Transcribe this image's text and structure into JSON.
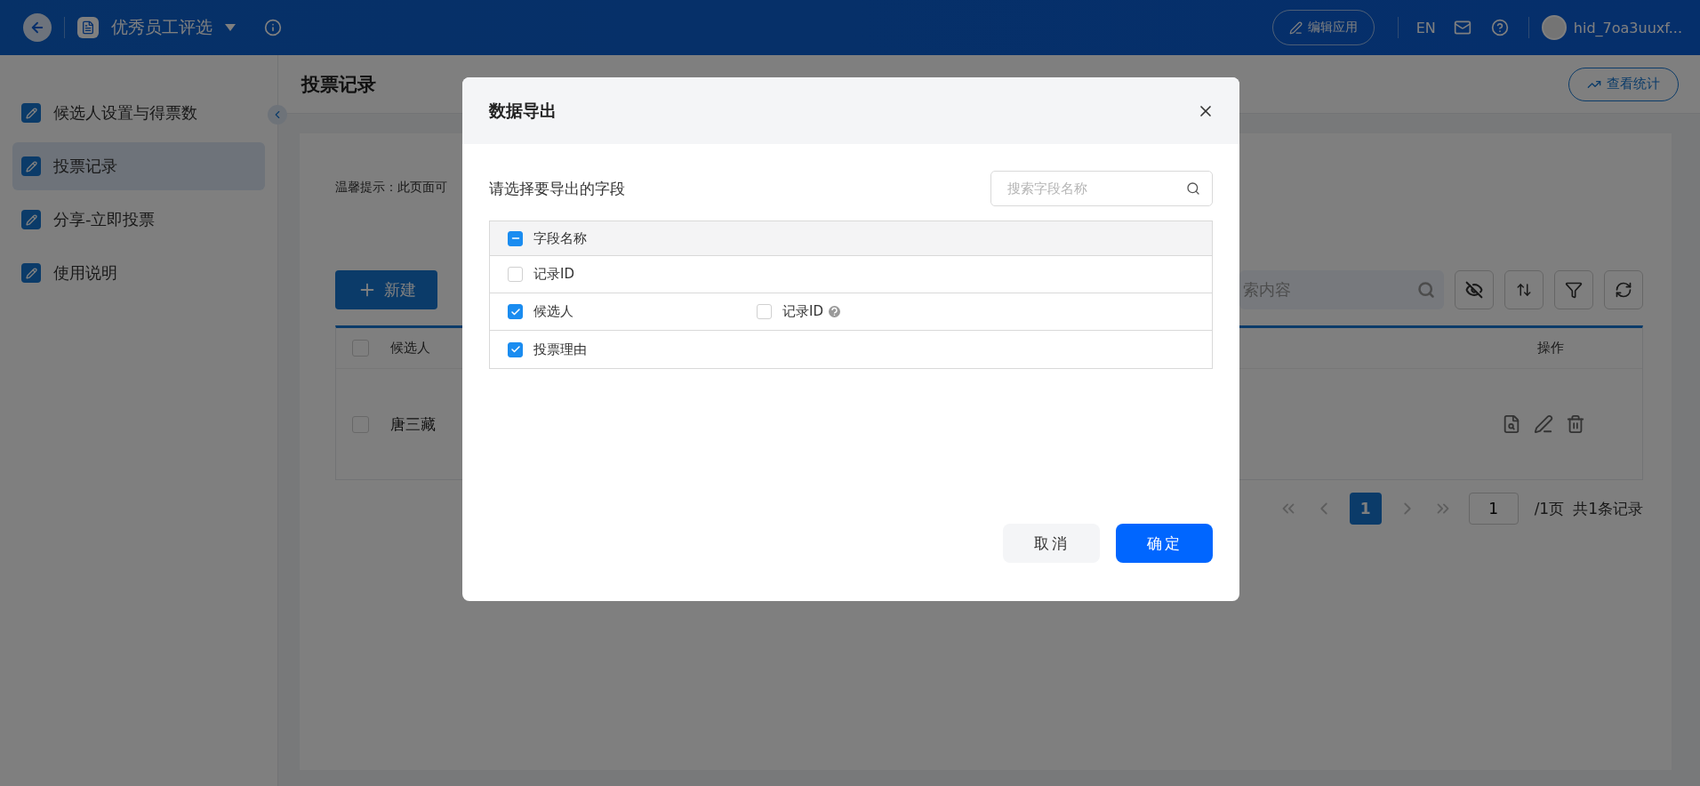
{
  "topbar": {
    "app_title": "优秀员工评选",
    "edit_button": "编辑应用",
    "language": "EN",
    "username": "hid_7oa3uuxf..."
  },
  "sidebar": {
    "items": [
      {
        "label": "候选人设置与得票数",
        "selected": false
      },
      {
        "label": "投票记录",
        "selected": true
      },
      {
        "label": "分享-立即投票",
        "selected": false
      },
      {
        "label": "使用说明",
        "selected": false
      }
    ]
  },
  "page": {
    "title": "投票记录",
    "stats_button": "查看统计",
    "tip": "温馨提示：此页面可",
    "new_button": "新建",
    "search": {
      "placeholder": "索内容"
    },
    "table": {
      "select_all": {
        "checked": false
      },
      "columns": [
        "候选人",
        "操作"
      ],
      "rows": [
        {
          "checked": false,
          "cells": [
            "唐三藏"
          ]
        }
      ]
    },
    "pagination": {
      "pages": [
        {
          "label": "1",
          "selected": true
        }
      ],
      "page_input": "1",
      "page_total": "/1页",
      "record_total": "共1条记录"
    }
  },
  "dialog": {
    "title": "数据导出",
    "prompt": "请选择要导出的字段",
    "search": {
      "placeholder": "搜索字段名称"
    },
    "header": {
      "label": "字段名称",
      "checked": true,
      "partial": true
    },
    "fields": [
      {
        "label": "记录ID",
        "checked": false
      },
      {
        "label": "候选人",
        "checked": true,
        "sub_fields": [
          {
            "label": "记录ID",
            "checked": false,
            "help": true
          }
        ]
      },
      {
        "label": "投票理由",
        "checked": true
      }
    ],
    "buttons": [
      {
        "label": "取消",
        "kind": "secondary"
      },
      {
        "label": "确定",
        "kind": "primary"
      }
    ]
  }
}
